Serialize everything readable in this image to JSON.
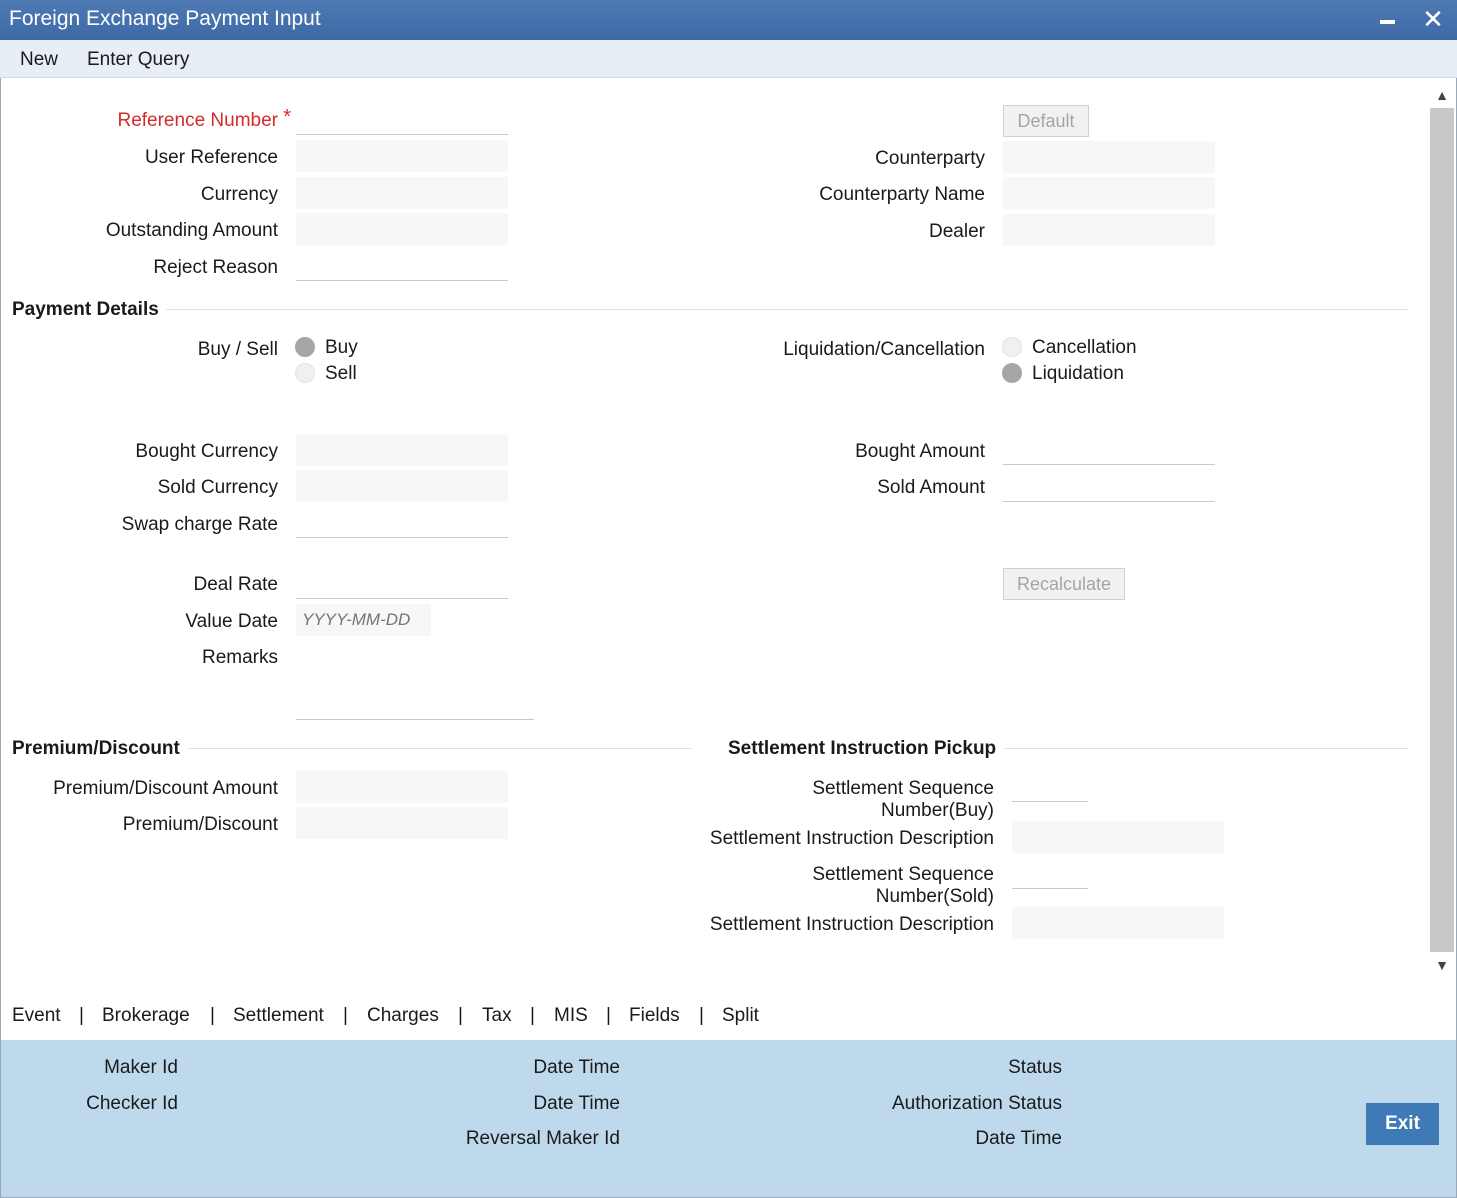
{
  "window": {
    "title": "Foreign Exchange Payment Input"
  },
  "menu": {
    "new": "New",
    "enter_query": "Enter Query"
  },
  "header": {
    "reference_number": {
      "label": "Reference Number",
      "value": ""
    },
    "user_reference": {
      "label": "User Reference",
      "value": ""
    },
    "currency": {
      "label": "Currency",
      "value": ""
    },
    "outstanding_amount": {
      "label": "Outstanding Amount",
      "value": ""
    },
    "reject_reason": {
      "label": "Reject Reason",
      "value": ""
    },
    "default_button": "Default",
    "counterparty": {
      "label": "Counterparty",
      "value": ""
    },
    "counterparty_name": {
      "label": "Counterparty Name",
      "value": ""
    },
    "dealer": {
      "label": "Dealer",
      "value": ""
    }
  },
  "payment_details": {
    "title": "Payment Details",
    "buy_sell": {
      "label": "Buy / Sell",
      "options": [
        "Buy",
        "Sell"
      ],
      "selected": "Buy"
    },
    "liquidation": {
      "label": "Liquidation/Cancellation",
      "options": [
        "Cancellation",
        "Liquidation"
      ],
      "selected": "Liquidation"
    },
    "bought_currency": {
      "label": "Bought Currency",
      "value": ""
    },
    "sold_currency": {
      "label": "Sold Currency",
      "value": ""
    },
    "swap_charge_rate": {
      "label": "Swap charge Rate",
      "value": ""
    },
    "bought_amount": {
      "label": "Bought Amount",
      "value": ""
    },
    "sold_amount": {
      "label": "Sold Amount",
      "value": ""
    },
    "deal_rate": {
      "label": "Deal Rate",
      "value": ""
    },
    "value_date": {
      "label": "Value Date",
      "placeholder": "YYYY-MM-DD"
    },
    "remarks": {
      "label": "Remarks",
      "value": ""
    },
    "recalculate_button": "Recalculate"
  },
  "premium_discount": {
    "title": "Premium/Discount",
    "amount": {
      "label": "Premium/Discount Amount",
      "value": ""
    },
    "type": {
      "label": "Premium/Discount",
      "value": ""
    }
  },
  "settlement_pickup": {
    "title": "Settlement Instruction Pickup",
    "seq_buy": {
      "label": "Settlement Sequence Number(Buy)",
      "value": ""
    },
    "desc_buy": {
      "label": "Settlement Instruction Description",
      "value": ""
    },
    "seq_sold": {
      "label": "Settlement Sequence Number(Sold)",
      "value": ""
    },
    "desc_sold": {
      "label": "Settlement Instruction Description",
      "value": ""
    }
  },
  "tabs": [
    "Event",
    "Brokerage",
    "Settlement",
    "Charges",
    "Tax",
    "MIS",
    "Fields",
    "Split"
  ],
  "tab_separator": "|",
  "footer": {
    "maker_id": "Maker Id",
    "checker_id": "Checker Id",
    "date_time_1": "Date Time",
    "date_time_2": "Date Time",
    "reversal_maker_id": "Reversal Maker Id",
    "status": "Status",
    "authorization_status": "Authorization Status",
    "date_time_3": "Date Time",
    "exit_button": "Exit"
  }
}
